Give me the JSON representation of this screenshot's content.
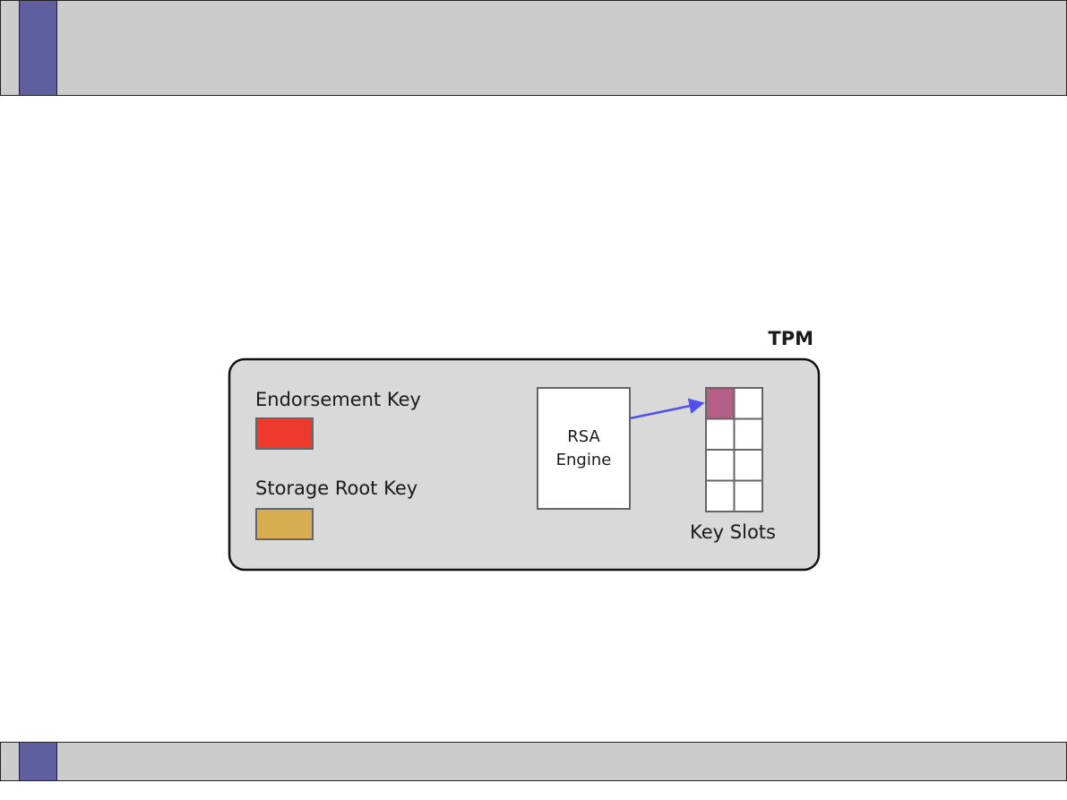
{
  "diagram": {
    "tpm_label": "TPM",
    "endorsement_key": {
      "label": "Endorsement Key",
      "color": "#ee3a2e"
    },
    "storage_root_key": {
      "label": "Storage Root Key",
      "color": "#d9ad52"
    },
    "rsa_engine": {
      "line1": "RSA",
      "line2": "Engine"
    },
    "key_slots": {
      "label": "Key Slots",
      "occupied_color": "#b35f86",
      "rows": 4,
      "cols": 2
    },
    "arrow_color": "#5050ee"
  },
  "colors": {
    "band": "#cccccc",
    "accent": "#5f5f9f",
    "tpm_box": "#d9d9d9"
  }
}
